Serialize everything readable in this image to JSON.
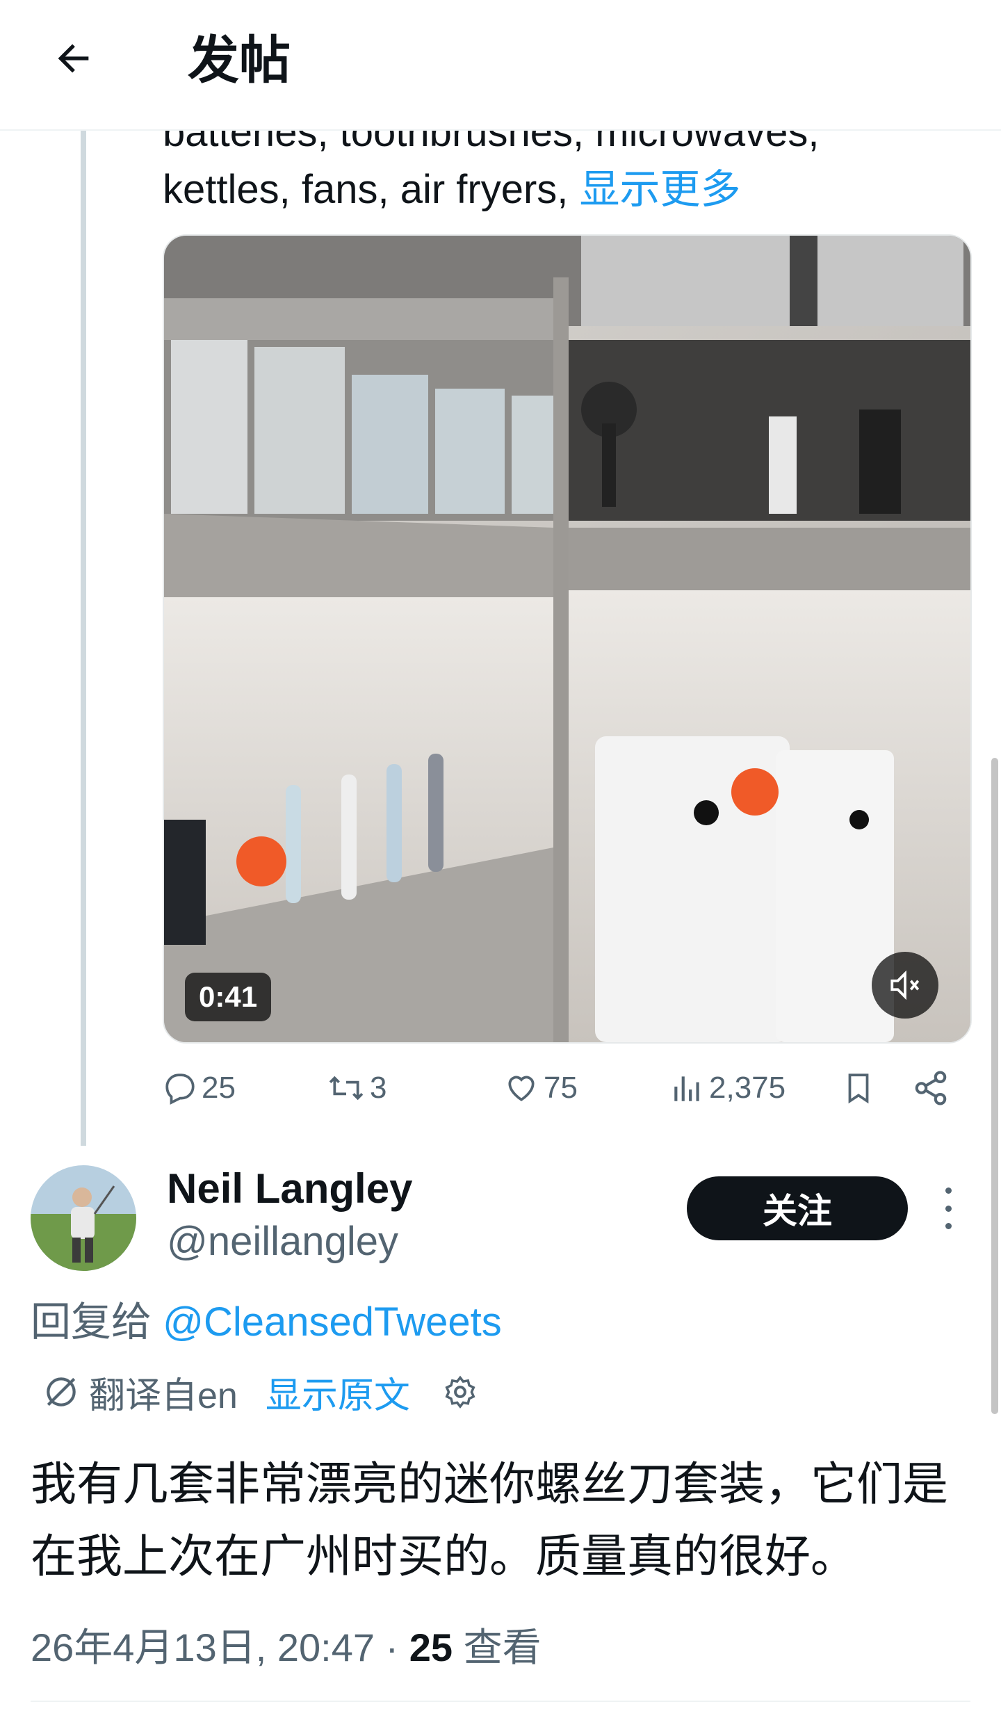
{
  "header": {
    "title": "发帖",
    "back_icon": "back-arrow-icon"
  },
  "quoted_tweet": {
    "text_line_cut": "batteries, toothbrushes, microwaves,",
    "text_line": "kettles, fans, air fryers,",
    "show_more": "显示更多",
    "media": {
      "duration": "0:41",
      "mute_icon": "volume-muted-icon"
    },
    "actions": {
      "replies": "25",
      "retweets": "3",
      "likes": "75",
      "views": "2,375"
    }
  },
  "reply": {
    "author_name": "Neil Langley",
    "author_handle": "@neillangley",
    "follow_label": "关注",
    "reply_to_prefix": "回复给 ",
    "reply_to_mention": "@CleansedTweets",
    "translated_from": "翻译自en",
    "show_original": "显示原文",
    "body": "我有几套非常漂亮的迷你螺丝刀套装，它们是在我上次在广州时买的。质量真的很好。",
    "timestamp": "26年4月13日, 20:47 · ",
    "view_count": "25",
    "view_label": " 查看"
  },
  "colors": {
    "accent": "#1d9bf0",
    "text": "#0f1419",
    "secondary": "#536471",
    "follow_bg": "#0f1419"
  }
}
